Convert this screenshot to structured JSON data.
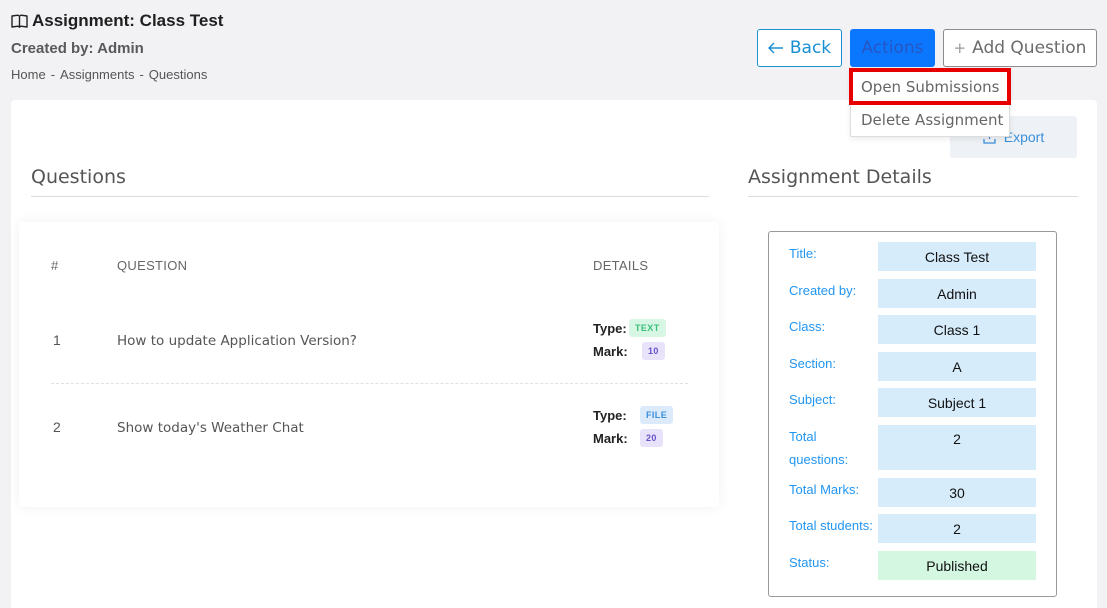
{
  "header": {
    "title": "Assignment: Class Test",
    "created_by": "Created by: Admin",
    "breadcrumb": [
      "Home",
      "Assignments",
      "Questions"
    ],
    "breadcrumb_sep": "-"
  },
  "toolbar": {
    "back_label": "Back",
    "actions_label": "Actions",
    "add_question_label": "Add Question",
    "export_label": "Export"
  },
  "dropdown": {
    "items": [
      "Open Submissions",
      "Delete Assignment"
    ]
  },
  "questions": {
    "title": "Questions",
    "columns": [
      "#",
      "QUESTION",
      "DETAILS"
    ],
    "type_label": "Type:",
    "mark_label": "Mark:",
    "rows": [
      {
        "num": "1",
        "question": "How to update Application Version?",
        "type": "TEXT",
        "mark": "10"
      },
      {
        "num": "2",
        "question": "Show today's Weather Chat",
        "type": "FILE",
        "mark": "20"
      }
    ]
  },
  "details": {
    "title": "Assignment Details",
    "fields": [
      {
        "label": "Title:",
        "value": "Class Test"
      },
      {
        "label": "Created by:",
        "value": "Admin"
      },
      {
        "label": "Class:",
        "value": "Class 1"
      },
      {
        "label": "Section:",
        "value": "A"
      },
      {
        "label": "Subject:",
        "value": "Subject 1"
      },
      {
        "label": "Total questions:",
        "value": "2"
      },
      {
        "label": "Total Marks:",
        "value": "30"
      },
      {
        "label": "Total students:",
        "value": "2"
      },
      {
        "label": "Status:",
        "value": "Published"
      }
    ]
  },
  "colors": {
    "accent": "#0b77ff",
    "link": "#2196f3",
    "highlight": "#e60000"
  }
}
